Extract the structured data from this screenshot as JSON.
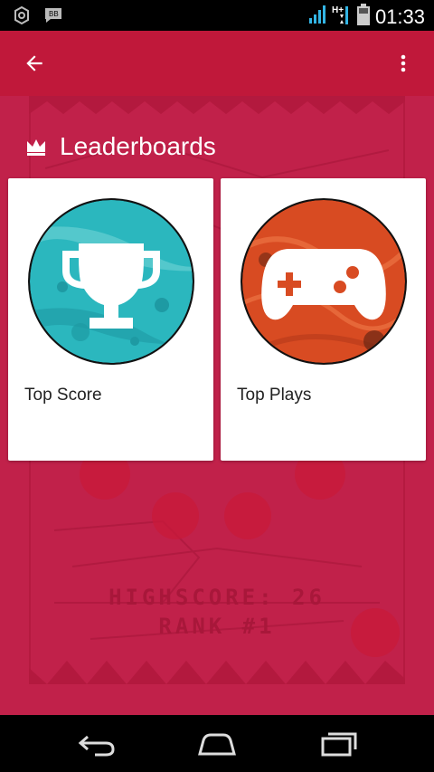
{
  "status_bar": {
    "time": "01:33",
    "icons": [
      "settings-gear-icon",
      "bbm-icon",
      "signal-icon",
      "network-hplus-icon",
      "battery-icon"
    ]
  },
  "app_bar": {
    "back_icon": "arrow-left-icon",
    "menu_icon": "more-vert-icon",
    "color": "#c0183a"
  },
  "section": {
    "title": "Leaderboards",
    "icon": "crown-icon"
  },
  "leaderboards": [
    {
      "label": "Top Score",
      "icon": "trophy-icon",
      "color": "#2bb7be"
    },
    {
      "label": "Top Plays",
      "icon": "gamepad-icon",
      "color": "#d84b22"
    }
  ],
  "background": {
    "highscore_text": "HIGHSCORE: 26",
    "rank_text": "RANK #1",
    "color": "#c1214a"
  },
  "nav_bar": {
    "back": "back-icon",
    "home": "home-icon",
    "recents": "recents-icon"
  }
}
